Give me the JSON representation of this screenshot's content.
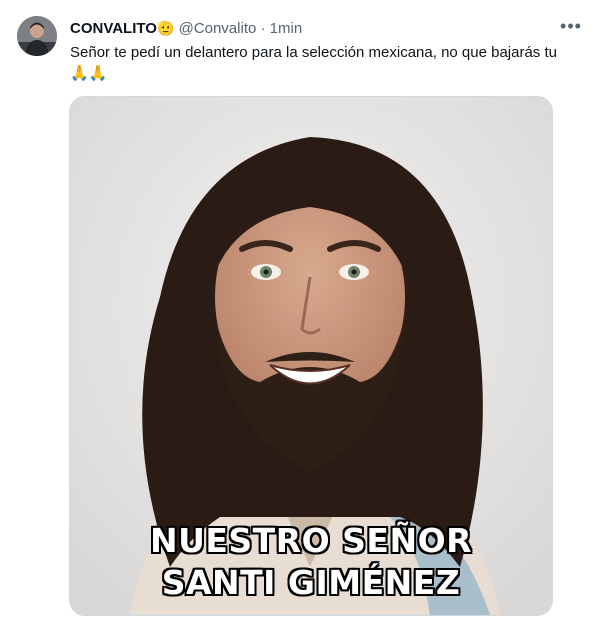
{
  "tweet": {
    "display_name": "CONVALITO",
    "badge_emoji": "🫡",
    "handle": "@Convalito",
    "separator": "·",
    "time": "1min",
    "text_line1": "Señor te pedí un delantero para la selección mexicana, no que bajarás tu",
    "text_line2": "🙏🙏",
    "more_icon": "more-horizontal-icon"
  },
  "media": {
    "caption_line1": "NUESTRO SEÑOR",
    "caption_line2": "SANTI GIMÉNEZ"
  }
}
